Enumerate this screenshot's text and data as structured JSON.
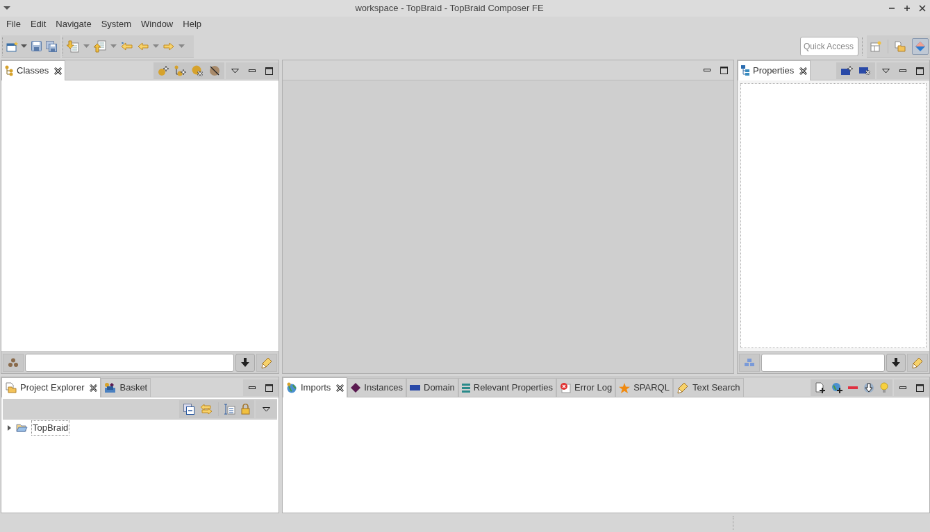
{
  "window": {
    "title": "workspace - TopBraid - TopBraid Composer FE"
  },
  "menu": [
    "File",
    "Edit",
    "Navigate",
    "System",
    "Window",
    "Help"
  ],
  "quick_access": {
    "placeholder": "Quick Access"
  },
  "classes_view": {
    "tabs": [
      {
        "label": "Classes",
        "selected": true
      }
    ]
  },
  "properties_view": {
    "tabs": [
      {
        "label": "Properties",
        "selected": true
      }
    ]
  },
  "explorer_view": {
    "tabs": [
      {
        "label": "Project Explorer",
        "selected": true
      },
      {
        "label": "Basket",
        "selected": false
      }
    ],
    "tree": [
      {
        "label": "TopBraid",
        "expanded": false,
        "focused": true
      }
    ]
  },
  "bottom_view": {
    "tabs": [
      {
        "label": "Imports",
        "selected": true
      },
      {
        "label": "Instances",
        "selected": false
      },
      {
        "label": "Domain",
        "selected": false
      },
      {
        "label": "Relevant Properties",
        "selected": false
      },
      {
        "label": "Error Log",
        "selected": false
      },
      {
        "label": "SPARQL",
        "selected": false
      },
      {
        "label": "Text Search",
        "selected": false
      }
    ]
  }
}
